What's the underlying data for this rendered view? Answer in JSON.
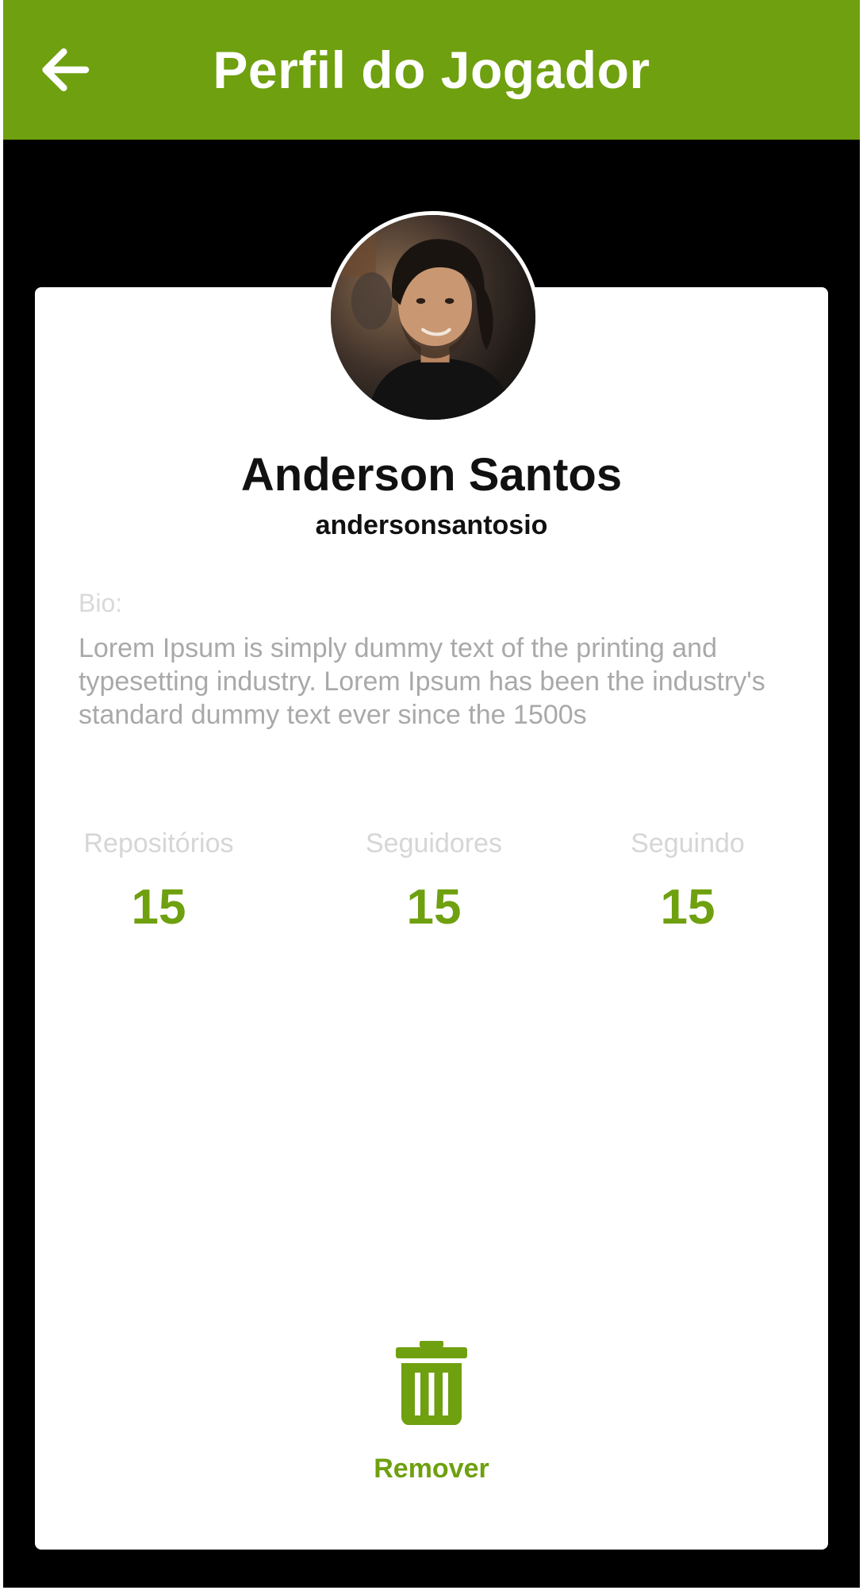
{
  "header": {
    "title": "Perfil do Jogador",
    "back_icon": "arrow-left-icon",
    "background": "#6fa00f"
  },
  "profile": {
    "name": "Anderson Santos",
    "username": "andersonsantosio",
    "bio_label": "Bio:",
    "bio_text": "Lorem Ipsum is simply dummy text of the printing and typesetting industry. Lorem Ipsum has been the industry's standard dummy text ever since the 1500s"
  },
  "stats": [
    {
      "label": "Repositórios",
      "value": "15"
    },
    {
      "label": "Seguidores",
      "value": "15"
    },
    {
      "label": "Seguindo",
      "value": "15"
    }
  ],
  "actions": {
    "remove_label": "Remover",
    "remove_icon": "trash-icon"
  },
  "colors": {
    "accent": "#6fa00f",
    "page_background": "#000000",
    "card_background": "#ffffff"
  }
}
